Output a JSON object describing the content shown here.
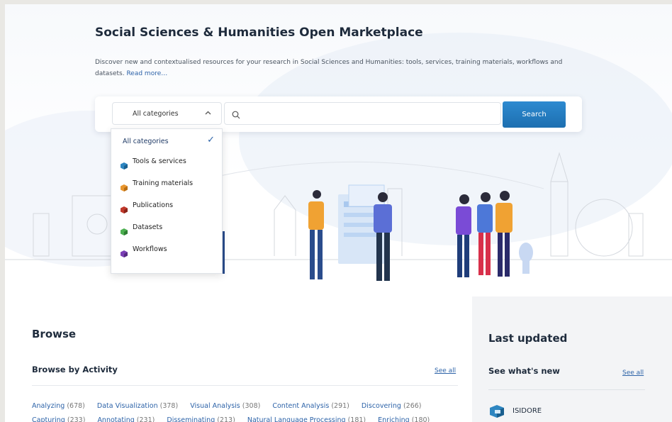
{
  "hero": {
    "title": "Social Sciences & Humanities Open Marketplace",
    "description": "Discover new and contextualised resources for your research in Social Sciences and Humanities: tools, services, training materials, workflows and datasets.",
    "read_more": "Read more…"
  },
  "search": {
    "category_selected": "All categories",
    "query_value": "",
    "button_label": "Search"
  },
  "dropdown": {
    "items": [
      {
        "label": "All categories",
        "selected": true
      },
      {
        "label": "Tools & services",
        "color": "#2e86c1"
      },
      {
        "label": "Training materials",
        "color": "#e8962e"
      },
      {
        "label": "Publications",
        "color": "#c0392b"
      },
      {
        "label": "Datasets",
        "color": "#4caf50"
      },
      {
        "label": "Workflows",
        "color": "#7b3fb5"
      }
    ]
  },
  "browse": {
    "heading": "Browse",
    "sub_heading": "Browse by Activity",
    "see_all": "See all",
    "activities": [
      {
        "name": "Analyzing",
        "count": "(678)"
      },
      {
        "name": "Data Visualization",
        "count": "(378)"
      },
      {
        "name": "Visual Analysis",
        "count": "(308)"
      },
      {
        "name": "Content Analysis",
        "count": "(291)"
      },
      {
        "name": "Discovering",
        "count": "(266)"
      },
      {
        "name": "Capturing",
        "count": "(233)"
      },
      {
        "name": "Annotating",
        "count": "(231)"
      },
      {
        "name": "Disseminating",
        "count": "(213)"
      },
      {
        "name": "Natural Language Processing",
        "count": "(181)"
      },
      {
        "name": "Enriching",
        "count": "(180)"
      }
    ]
  },
  "last_updated": {
    "heading": "Last updated",
    "sub_heading": "See what's new",
    "see_all": "See all",
    "items": [
      {
        "name": "ISIDORE"
      }
    ]
  }
}
